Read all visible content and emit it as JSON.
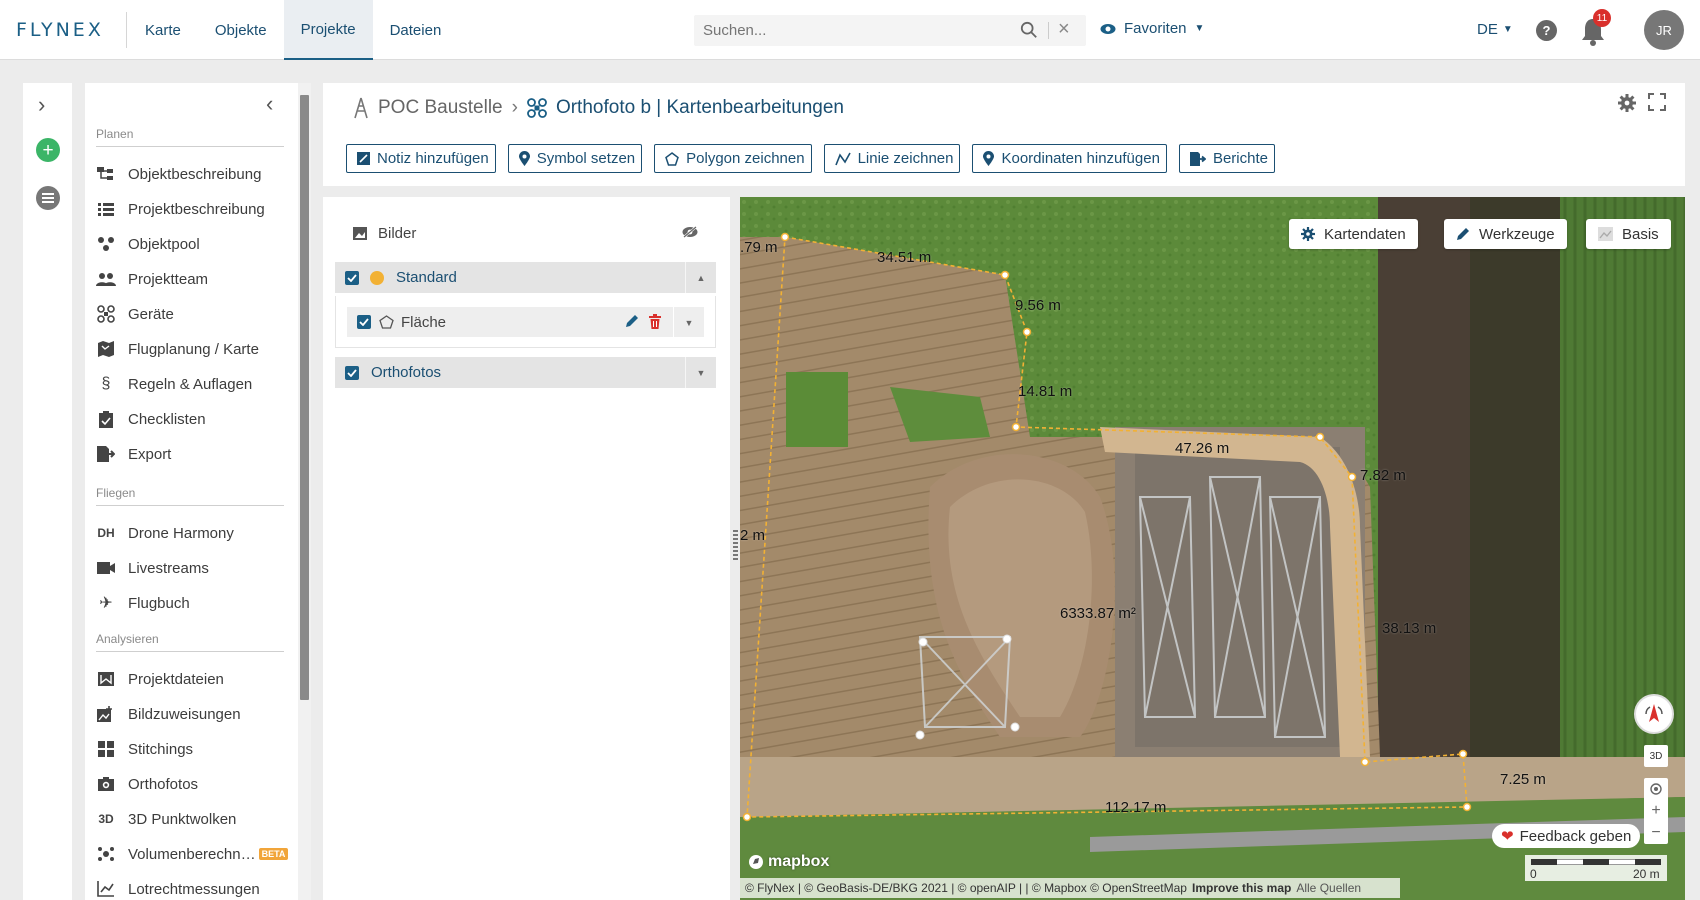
{
  "app": {
    "logo": "FLYNEX"
  },
  "nav": {
    "items": [
      "Karte",
      "Objekte",
      "Projekte",
      "Dateien"
    ],
    "active": "Projekte"
  },
  "search": {
    "placeholder": "Suchen..."
  },
  "favorites": {
    "label": "Favoriten"
  },
  "language": "DE",
  "notifications": {
    "count": "11"
  },
  "user": {
    "initials": "JR"
  },
  "sidebar": {
    "sections": {
      "planen": "Planen",
      "fliegen": "Fliegen",
      "analysieren": "Analysieren"
    },
    "planen_items": [
      {
        "label": "Objektbeschreibung",
        "icon": "hierarchy-icon"
      },
      {
        "label": "Projektbeschreibung",
        "icon": "list-icon"
      },
      {
        "label": "Objektpool",
        "icon": "pool-icon"
      },
      {
        "label": "Projektteam",
        "icon": "team-icon"
      },
      {
        "label": "Geräte",
        "icon": "drone-icon"
      },
      {
        "label": "Flugplanung / Karte",
        "icon": "map-icon"
      },
      {
        "label": "Regeln & Auflagen",
        "icon": "paragraph-icon"
      },
      {
        "label": "Checklisten",
        "icon": "clipboard-icon"
      },
      {
        "label": "Export",
        "icon": "export-icon"
      }
    ],
    "fliegen_items": [
      {
        "label": "Drone Harmony",
        "icon": "dh-icon",
        "glyph": "DH"
      },
      {
        "label": "Livestreams",
        "icon": "live-icon"
      },
      {
        "label": "Flugbuch",
        "icon": "plane-icon"
      }
    ],
    "analysieren_items": [
      {
        "label": "Projektdateien",
        "icon": "files-icon"
      },
      {
        "label": "Bildzuweisungen",
        "icon": "image-assign-icon"
      },
      {
        "label": "Stitchings",
        "icon": "stitching-icon"
      },
      {
        "label": "Orthofotos",
        "icon": "camera-icon"
      },
      {
        "label": "3D Punktwolken",
        "icon": "3d-icon",
        "glyph": "3D"
      },
      {
        "label": "Volumenberechn…",
        "icon": "volume-icon",
        "badge": "BETA"
      },
      {
        "label": "Lotrechtmessungen",
        "icon": "plumb-icon"
      }
    ]
  },
  "breadcrumb": {
    "root": "POC Baustelle",
    "current": "Orthofoto b | Kartenbearbeitungen"
  },
  "toolbar": [
    {
      "label": "Notiz hinzufügen",
      "icon": "note-icon"
    },
    {
      "label": "Symbol setzen",
      "icon": "pin-icon"
    },
    {
      "label": "Polygon zeichnen",
      "icon": "polygon-icon"
    },
    {
      "label": "Linie zeichnen",
      "icon": "line-icon"
    },
    {
      "label": "Koordinaten hinzufügen",
      "icon": "pin-icon"
    },
    {
      "label": "Berichte",
      "icon": "report-icon"
    }
  ],
  "layers": {
    "title": "Bilder",
    "groups": [
      {
        "label": "Standard",
        "checked": true,
        "expanded": true,
        "children": [
          {
            "label": "Fläche",
            "checked": true
          }
        ]
      },
      {
        "label": "Orthofotos",
        "checked": true,
        "expanded": false
      }
    ]
  },
  "map": {
    "buttons": [
      "Kartendaten",
      "Werkzeuge",
      "Basis"
    ],
    "measurements": [
      "34.51 m",
      "9.56 m",
      "14.81 m",
      "47.26 m",
      "7.82 m",
      "38.13 m",
      "7.25 m",
      "112.17 m",
      ".79 m",
      "2 m"
    ],
    "area": "6333.87 m²",
    "feedback": "Feedback geben",
    "btn3d": "3D",
    "scale": {
      "left": "0",
      "right": "20 m"
    },
    "mapbox": "mapbox",
    "attribution": {
      "text": "© FlyNex | © GeoBasis-DE/BKG 2021 | © openAIP | | © Mapbox © OpenStreetMap",
      "improve": "Improve this map",
      "sources": "Alle Quellen"
    },
    "colors": {
      "polygon": "#f2b134",
      "accent": "#1b5f86"
    }
  }
}
